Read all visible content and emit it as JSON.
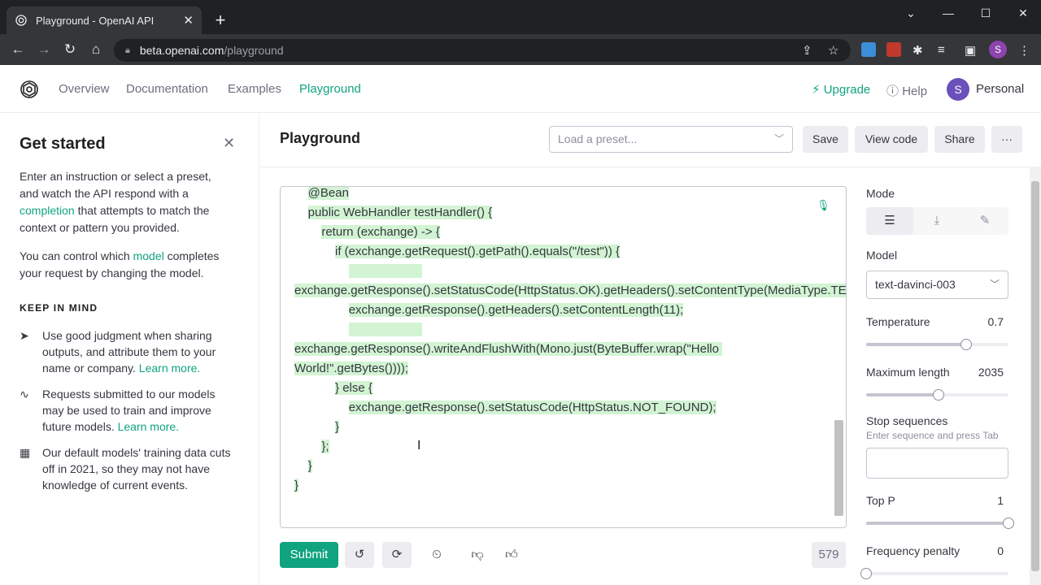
{
  "browser": {
    "tab_title": "Playground - OpenAI API",
    "close_tab": "✕",
    "new_tab": "+",
    "url_host": "beta.openai.com",
    "url_path": "/playground",
    "profile_initial": "S"
  },
  "nav": {
    "links": [
      "Overview",
      "Documentation",
      "Examples",
      "Playground"
    ],
    "active": "Playground",
    "upgrade": "Upgrade",
    "help": "Help",
    "avatar_initial": "S",
    "account": "Personal"
  },
  "sidebar": {
    "title": "Get started",
    "intro_1": "Enter an instruction or select a preset, and watch the API respond with a ",
    "intro_link": "completion",
    "intro_2": " that attempts to match the context or pattern you provided.",
    "model_1": "You can control which ",
    "model_link": "model",
    "model_2": " completes your request by changing the model.",
    "keep_heading": "KEEP IN MIND",
    "item1_text": "Use good judgment when sharing outputs, and attribute them to your name or company. ",
    "item1_link": "Learn more.",
    "item2_text": "Requests submitted to our models may be used to train and improve future models. ",
    "item2_link": "Learn more.",
    "item3_text": "Our default models' training data cuts off in 2021, so they may not have knowledge of current events."
  },
  "header": {
    "title": "Playground",
    "preset_placeholder": "Load a preset...",
    "save": "Save",
    "view_code": "View code",
    "share": "Share",
    "more": "···"
  },
  "editor": {
    "lines": [
      {
        "indent": "    ",
        "text": "@Bean",
        "hl": true
      },
      {
        "indent": "    ",
        "text": "public WebHandler testHandler() {",
        "hl": true
      },
      {
        "indent": "        ",
        "text": "return (exchange) -> {",
        "hl": true
      },
      {
        "indent": "            ",
        "text": "if (exchange.getRequest().getPath().equals(\"/test\")) {",
        "hl": true
      },
      {
        "indent": "                ",
        "text": "",
        "hl": true
      },
      {
        "indent": "",
        "text": "exchange.getResponse().setStatusCode(HttpStatus.OK).getHeaders().setContentType(MediaType.TEXT_PLAIN);",
        "hl": true
      },
      {
        "indent": "                ",
        "text": "exchange.getResponse().getHeaders().setContentLength(11);",
        "hl": true
      },
      {
        "indent": "                ",
        "text": "",
        "hl": true
      },
      {
        "indent": "",
        "text": "exchange.getResponse().writeAndFlushWith(Mono.just(ByteBuffer.wrap(\"Hello World!\".getBytes())));",
        "hl": true
      },
      {
        "indent": "            ",
        "text": "} else {",
        "hl": true
      },
      {
        "indent": "                ",
        "text": "exchange.getResponse().setStatusCode(HttpStatus.NOT_FOUND);",
        "hl": true
      },
      {
        "indent": "            ",
        "text": "}",
        "hl": true
      },
      {
        "indent": "        ",
        "text": "};",
        "hl": true
      },
      {
        "indent": "    ",
        "text": "}",
        "hl": true
      },
      {
        "indent": "",
        "text": "}",
        "hl": true
      }
    ]
  },
  "footer": {
    "submit": "Submit",
    "token_count": "579"
  },
  "settings": {
    "mode_label": "Mode",
    "model_label": "Model",
    "model_value": "text-davinci-003",
    "temperature_label": "Temperature",
    "temperature_value": "0.7",
    "temperature_fraction": 0.7,
    "max_length_label": "Maximum length",
    "max_length_value": "2035",
    "max_length_fraction": 0.51,
    "stop_label": "Stop sequences",
    "stop_hint": "Enter sequence and press Tab",
    "top_p_label": "Top P",
    "top_p_value": "1",
    "top_p_fraction": 1.0,
    "freq_label": "Frequency penalty",
    "freq_value": "0",
    "freq_fraction": 0.0
  },
  "colors": {
    "accent": "#10a37f",
    "highlight": "#d2f4d3"
  }
}
